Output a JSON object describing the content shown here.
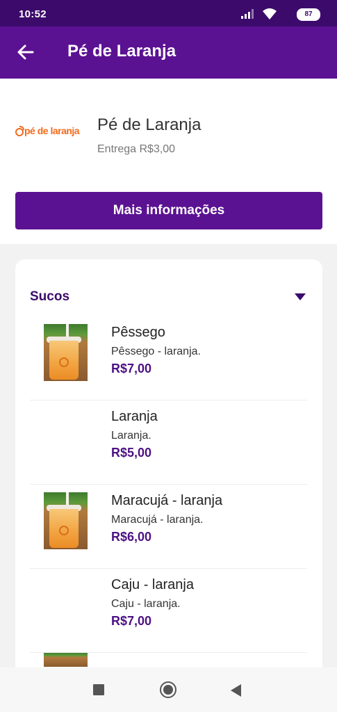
{
  "status_bar": {
    "time": "10:52",
    "battery": "87",
    "icons": [
      "signal-icon",
      "wifi-icon",
      "battery-icon"
    ]
  },
  "app_bar": {
    "title": "Pé de Laranja",
    "back_icon": "arrow-left-icon"
  },
  "store": {
    "logo_text": "pé de laranja",
    "name": "Pé de Laranja",
    "delivery": "Entrega R$3,00",
    "more_info_label": "Mais informações"
  },
  "menu": {
    "category": "Sucos",
    "expand_icon": "chevron-down-icon",
    "products": [
      {
        "name": "Pêssego",
        "description": "Pêssego - laranja.",
        "price": "R$7,00",
        "has_image": true
      },
      {
        "name": "Laranja",
        "description": "Laranja.",
        "price": "R$5,00",
        "has_image": false
      },
      {
        "name": "Maracujá - laranja",
        "description": "Maracujá - laranja.",
        "price": "R$6,00",
        "has_image": true
      },
      {
        "name": "Caju - laranja",
        "description": "Caju - laranja.",
        "price": "R$7,00",
        "has_image": false
      }
    ]
  },
  "nav_bar": {
    "icons": [
      "recents-square-icon",
      "home-circle-icon",
      "back-triangle-icon"
    ]
  },
  "colors": {
    "status_bar": "#3b0a6b",
    "app_bar": "#5b1292",
    "accent": "#5b1292",
    "price": "#4c1184",
    "logo": "#f26a1b"
  }
}
